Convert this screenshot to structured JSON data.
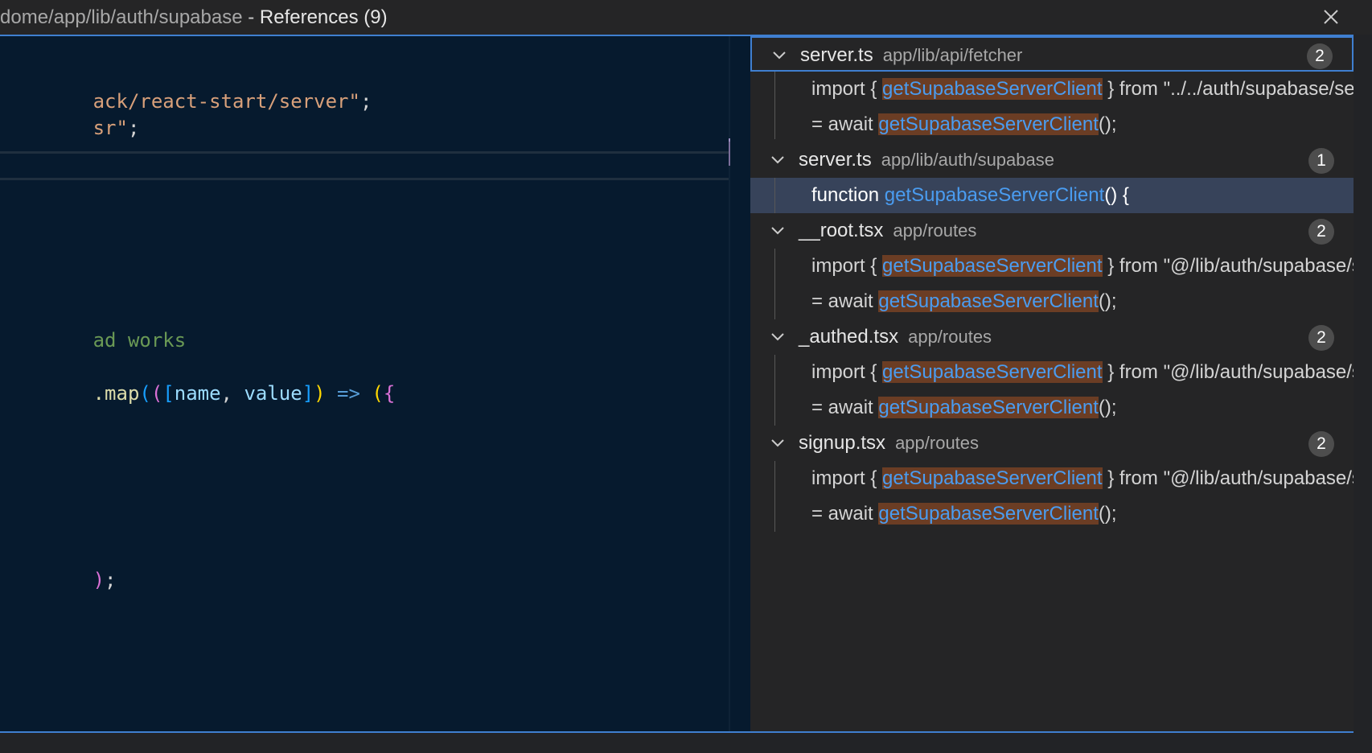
{
  "titlebar": {
    "path": "dome/app/lib/auth/supabase",
    "separator": " - ",
    "title": "References (9)",
    "close_icon": "close-icon"
  },
  "editor": {
    "lines": {
      "l1_str": "ack/react-start/server\"",
      "l1_punc": ";",
      "l2_str": "sr\"",
      "l2_punc": ";",
      "l3_comment": "ad works",
      "l4_map": ".map",
      "l4_p1": "(",
      "l4_p2": "(",
      "l4_p3": "[",
      "l4_name": "name",
      "l4_comma": ", ",
      "l4_value": "value",
      "l4_p3c": "]",
      "l4_p2c": ")",
      "l4_arrow": " => ",
      "l4_p2o": "(",
      "l4_p3o": "{",
      "l5_paren": ")",
      "l5_semi": ";"
    }
  },
  "references": {
    "groups": [
      {
        "file": "server.ts",
        "path": "app/lib/api/fetcher",
        "count": "2",
        "matches": [
          {
            "before": "import { ",
            "symbol": "getSupabaseServerClient",
            "after": " } from \"../../auth/supabase/server\";"
          },
          {
            "before": "= await ",
            "symbol": "getSupabaseServerClient",
            "after": "();"
          }
        ]
      },
      {
        "file": "server.ts",
        "path": "app/lib/auth/supabase",
        "count": "1",
        "matches": [
          {
            "before": "function ",
            "symbol": "getSupabaseServerClient",
            "after": "() {"
          }
        ]
      },
      {
        "file": "__root.tsx",
        "path": "app/routes",
        "count": "2",
        "matches": [
          {
            "before": "import { ",
            "symbol": "getSupabaseServerClient",
            "after": " } from \"@/lib/auth/supabase/server\";"
          },
          {
            "before": "= await ",
            "symbol": "getSupabaseServerClient",
            "after": "();"
          }
        ]
      },
      {
        "file": "_authed.tsx",
        "path": "app/routes",
        "count": "2",
        "matches": [
          {
            "before": "import { ",
            "symbol": "getSupabaseServerClient",
            "after": " } from \"@/lib/auth/supabase/server\";"
          },
          {
            "before": "= await ",
            "symbol": "getSupabaseServerClient",
            "after": "();"
          }
        ]
      },
      {
        "file": "signup.tsx",
        "path": "app/routes",
        "count": "2",
        "matches": [
          {
            "before": "import { ",
            "symbol": "getSupabaseServerClient",
            "after": " } from \"@/lib/auth/supabase/server\";"
          },
          {
            "before": "= await ",
            "symbol": "getSupabaseServerClient",
            "after": "();"
          }
        ]
      }
    ]
  },
  "colors": {
    "accent": "#3f7fd0",
    "editor_bg": "#061a2e",
    "panel_bg": "#252526",
    "symbol_highlight": "#6b3d24",
    "symbol_text": "#4a9cf0",
    "selected_row": "#37435a"
  }
}
